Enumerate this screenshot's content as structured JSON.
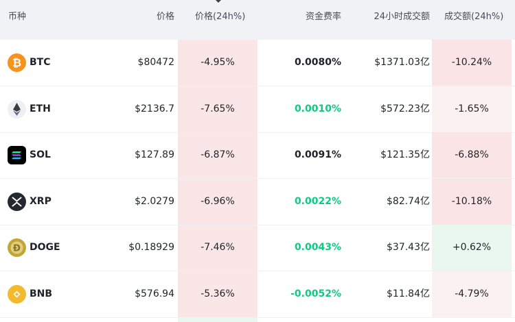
{
  "header": {
    "coin": "币种",
    "price": "价格",
    "change24h": "价格(24h%)",
    "funding": "资金费率",
    "volume24h": "24小时成交额",
    "volchange24h": "成交额(24h%)"
  },
  "colors": {
    "negative_bg": "#fbe6e7",
    "positive_bg": "#e9f7ee",
    "green_text": "#0ecb81",
    "dark_text": "#1e2329"
  },
  "rows": [
    {
      "symbol": "BTC",
      "icon": "bitcoin-icon",
      "price": "$80472",
      "change": "-4.95%",
      "funding": "0.0080%",
      "funding_sign": "neutral",
      "volume": "$1371.03亿",
      "volchange": "-10.24%",
      "vol_sign": "neg"
    },
    {
      "symbol": "ETH",
      "icon": "ethereum-icon",
      "price": "$2136.7",
      "change": "-7.65%",
      "funding": "0.0010%",
      "funding_sign": "pos",
      "volume": "$572.23亿",
      "volchange": "-1.65%",
      "vol_sign": "neg-light"
    },
    {
      "symbol": "SOL",
      "icon": "solana-icon",
      "price": "$127.89",
      "change": "-6.87%",
      "funding": "0.0091%",
      "funding_sign": "neutral",
      "volume": "$121.35亿",
      "volchange": "-6.88%",
      "vol_sign": "neg"
    },
    {
      "symbol": "XRP",
      "icon": "xrp-icon",
      "price": "$2.0279",
      "change": "-6.96%",
      "funding": "0.0022%",
      "funding_sign": "pos",
      "volume": "$82.74亿",
      "volchange": "-10.18%",
      "vol_sign": "neg"
    },
    {
      "symbol": "DOGE",
      "icon": "dogecoin-icon",
      "price": "$0.18929",
      "change": "-7.46%",
      "funding": "0.0043%",
      "funding_sign": "pos",
      "volume": "$37.43亿",
      "volchange": "+0.62%",
      "vol_sign": "pos"
    },
    {
      "symbol": "BNB",
      "icon": "bnb-icon",
      "price": "$576.94",
      "change": "-5.36%",
      "funding": "-0.0052%",
      "funding_sign": "pos",
      "volume": "$11.84亿",
      "volchange": "-4.79%",
      "vol_sign": "neg-light"
    }
  ]
}
